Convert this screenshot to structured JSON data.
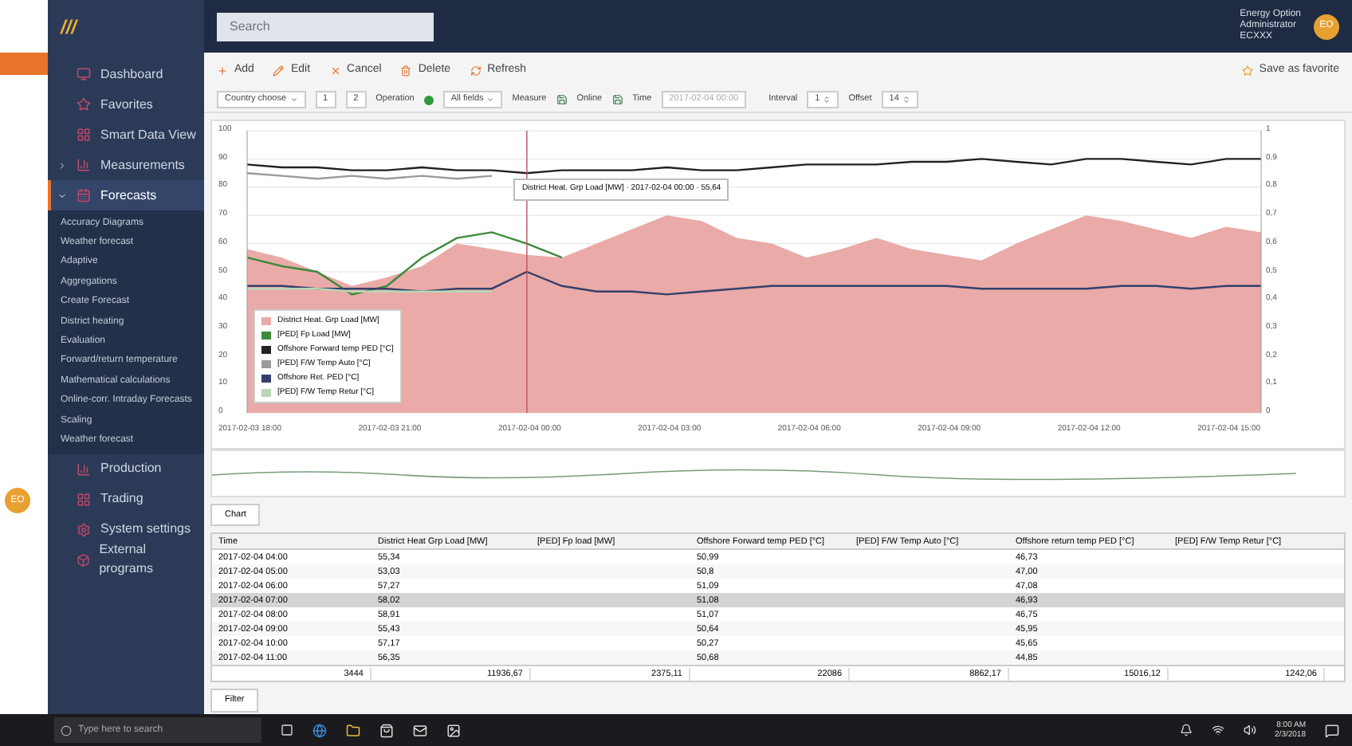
{
  "back_window": {
    "avatar": "EO"
  },
  "logo": "///",
  "search": {
    "placeholder": "Search"
  },
  "user": {
    "lines": [
      "Energy Option",
      "Administrator",
      "ECXXX"
    ],
    "avatar": "EO"
  },
  "sidebar": {
    "items": [
      {
        "label": "Dashboard",
        "selected": false
      },
      {
        "label": "Favorites",
        "selected": false
      },
      {
        "label": "Smart Data View",
        "selected": false
      },
      {
        "label": "Measurements",
        "selected": false,
        "expanded": false
      },
      {
        "label": "Forecasts",
        "selected": true,
        "expanded": true,
        "children": [
          {
            "label": "Accuracy Diagrams"
          },
          {
            "label": "Weather forecast"
          },
          {
            "label": "Adaptive"
          },
          {
            "label": "Aggregations"
          },
          {
            "label": "Create Forecast"
          },
          {
            "label": "District heating"
          },
          {
            "label": "Evaluation"
          },
          {
            "label": "Forward/return temperature"
          },
          {
            "label": "Mathematical calculations"
          },
          {
            "label": "Online-corr. Intraday Forecasts"
          },
          {
            "label": "Scaling"
          },
          {
            "label": "Weather forecast"
          }
        ]
      },
      {
        "label": "Production",
        "selected": false
      },
      {
        "label": "Trading",
        "selected": false
      },
      {
        "label": "System settings",
        "selected": false
      },
      {
        "label": "External programs",
        "selected": false
      }
    ]
  },
  "actions": [
    "Add",
    "Edit",
    "Cancel",
    "Delete",
    "Refresh"
  ],
  "favorite": "Save as favorite",
  "filters": {
    "entity": "Country choose",
    "pager": [
      "1",
      "2"
    ],
    "operation_label": "Operation",
    "operation_value": "All fields",
    "measure_label": "Measure",
    "online_label": "Online",
    "time_label": "Time",
    "time_value": "2017-02-04 00:00",
    "interval_label": "Interval",
    "interval_value": "1",
    "offset_label": "Offset",
    "offset_value": "14"
  },
  "chart": {
    "chart_data": {
      "type": "line",
      "categories": [
        "2017-02-03 18:00",
        null,
        null,
        null,
        "2017-02-03 21:00",
        null,
        null,
        null,
        "2017-02-04 00:00",
        null,
        null,
        null,
        "2017-02-04 03:00",
        null,
        null,
        null,
        "2017-02-04 06:00",
        null,
        null,
        null,
        "2017-02-04 09:00",
        null,
        null,
        null,
        "2017-02-04 12:00",
        null,
        null,
        null,
        "2017-02-04 15:00",
        null
      ],
      "ylim": [
        0,
        100
      ],
      "yticks": [
        0,
        10,
        20,
        30,
        40,
        50,
        60,
        70,
        80,
        90,
        100
      ],
      "series": [
        {
          "name": "District Heat. Grp Load [MW]",
          "color": "#e9aaa8",
          "type": "area",
          "values": [
            58,
            55,
            50,
            45,
            48,
            52,
            60,
            58,
            56,
            55,
            60,
            65,
            70,
            68,
            62,
            60,
            55,
            58,
            62,
            58,
            56,
            54,
            60,
            65,
            70,
            68,
            65,
            62,
            66,
            64
          ]
        },
        {
          "name": "[PED] Fp Load [MW]",
          "color": "#3c8a3c",
          "values": [
            55,
            52,
            50,
            42,
            45,
            55,
            62,
            64,
            60,
            55,
            null,
            null,
            null,
            null,
            null,
            null,
            null,
            null,
            null,
            null,
            null,
            null,
            null,
            null,
            null,
            null,
            null,
            null,
            null,
            null
          ]
        },
        {
          "name": "Offshore Forward temp PED [°C]",
          "color": "#222222",
          "values": [
            88,
            87,
            87,
            86,
            86,
            87,
            86,
            86,
            85,
            86,
            86,
            86,
            87,
            86,
            86,
            87,
            88,
            88,
            88,
            89,
            89,
            90,
            89,
            88,
            90,
            90,
            89,
            88,
            90,
            90
          ]
        },
        {
          "name": "[PED] F/W Temp Auto [°C]",
          "color": "#9a9a9a",
          "values": [
            85,
            84,
            83,
            84,
            83,
            84,
            83,
            84,
            null,
            null,
            null,
            null,
            null,
            null,
            null,
            null,
            null,
            null,
            null,
            null,
            null,
            null,
            null,
            null,
            null,
            null,
            null,
            null,
            null,
            null
          ]
        },
        {
          "name": "Offshore Ret. PED [°C]",
          "color": "#34406a",
          "values": [
            45,
            45,
            44,
            44,
            44,
            43,
            44,
            44,
            50,
            45,
            43,
            43,
            42,
            43,
            44,
            45,
            45,
            45,
            45,
            45,
            45,
            44,
            44,
            44,
            44,
            45,
            45,
            44,
            45,
            45
          ]
        },
        {
          "name": "[PED] F/W Temp Retur [°C]",
          "color": "#b8d8b8",
          "values": [
            44,
            44,
            44,
            43,
            43,
            43,
            43,
            43,
            null,
            null,
            null,
            null,
            null,
            null,
            null,
            null,
            null,
            null,
            null,
            null,
            null,
            null,
            null,
            null,
            null,
            null,
            null,
            null,
            null,
            null
          ]
        }
      ],
      "grid": true,
      "legend": "lower left",
      "annotations": [
        "District Heat. Grp Load [MW] · 2017-02-04 00:00 · 55,64"
      ]
    },
    "right_ticks": [
      "1",
      "0,9",
      "0,8",
      "0,7",
      "0,6",
      "0,5",
      "0,4",
      "0,3",
      "0,2",
      "0,1",
      "0"
    ]
  },
  "table_tab": "Chart",
  "table": {
    "columns": [
      "Time",
      "District Heat Grp Load [MW]",
      "[PED] Fp load [MW]",
      "Offshore Forward temp PED [°C]",
      "[PED] F/W Temp Auto [°C]",
      "Offshore return temp PED [°C]",
      "[PED] F/W Temp Retur [°C]"
    ],
    "rows": [
      {
        "cells": [
          "2017-02-04 04:00",
          "55,34",
          "",
          "50,99",
          "",
          "46,73",
          ""
        ],
        "selected": false
      },
      {
        "cells": [
          "2017-02-04 05:00",
          "53,03",
          "",
          "50,8",
          "",
          "47,00",
          ""
        ],
        "selected": false
      },
      {
        "cells": [
          "2017-02-04 06:00",
          "57,27",
          "",
          "51,09",
          "",
          "47,08",
          ""
        ],
        "selected": false
      },
      {
        "cells": [
          "2017-02-04 07:00",
          "58,02",
          "",
          "51,08",
          "",
          "46,93",
          ""
        ],
        "selected": true
      },
      {
        "cells": [
          "2017-02-04 08:00",
          "58,91",
          "",
          "51,07",
          "",
          "46,75",
          ""
        ],
        "selected": false
      },
      {
        "cells": [
          "2017-02-04 09:00",
          "55,43",
          "",
          "50,64",
          "",
          "45,95",
          ""
        ],
        "selected": false
      },
      {
        "cells": [
          "2017-02-04 10:00",
          "57,17",
          "",
          "50,27",
          "",
          "45,65",
          ""
        ],
        "selected": false
      },
      {
        "cells": [
          "2017-02-04 11:00",
          "56,35",
          "",
          "50,68",
          "",
          "44,85",
          ""
        ],
        "selected": false
      }
    ],
    "totals": [
      "3444",
      "11936,67",
      "2375,11",
      "22086",
      "8862,17",
      "15016,12",
      "1242,06"
    ]
  },
  "filter_tab": "Filter",
  "taskbar": {
    "search_placeholder": "Type here to search",
    "time": "8:00 AM",
    "date": "2/3/2018"
  }
}
